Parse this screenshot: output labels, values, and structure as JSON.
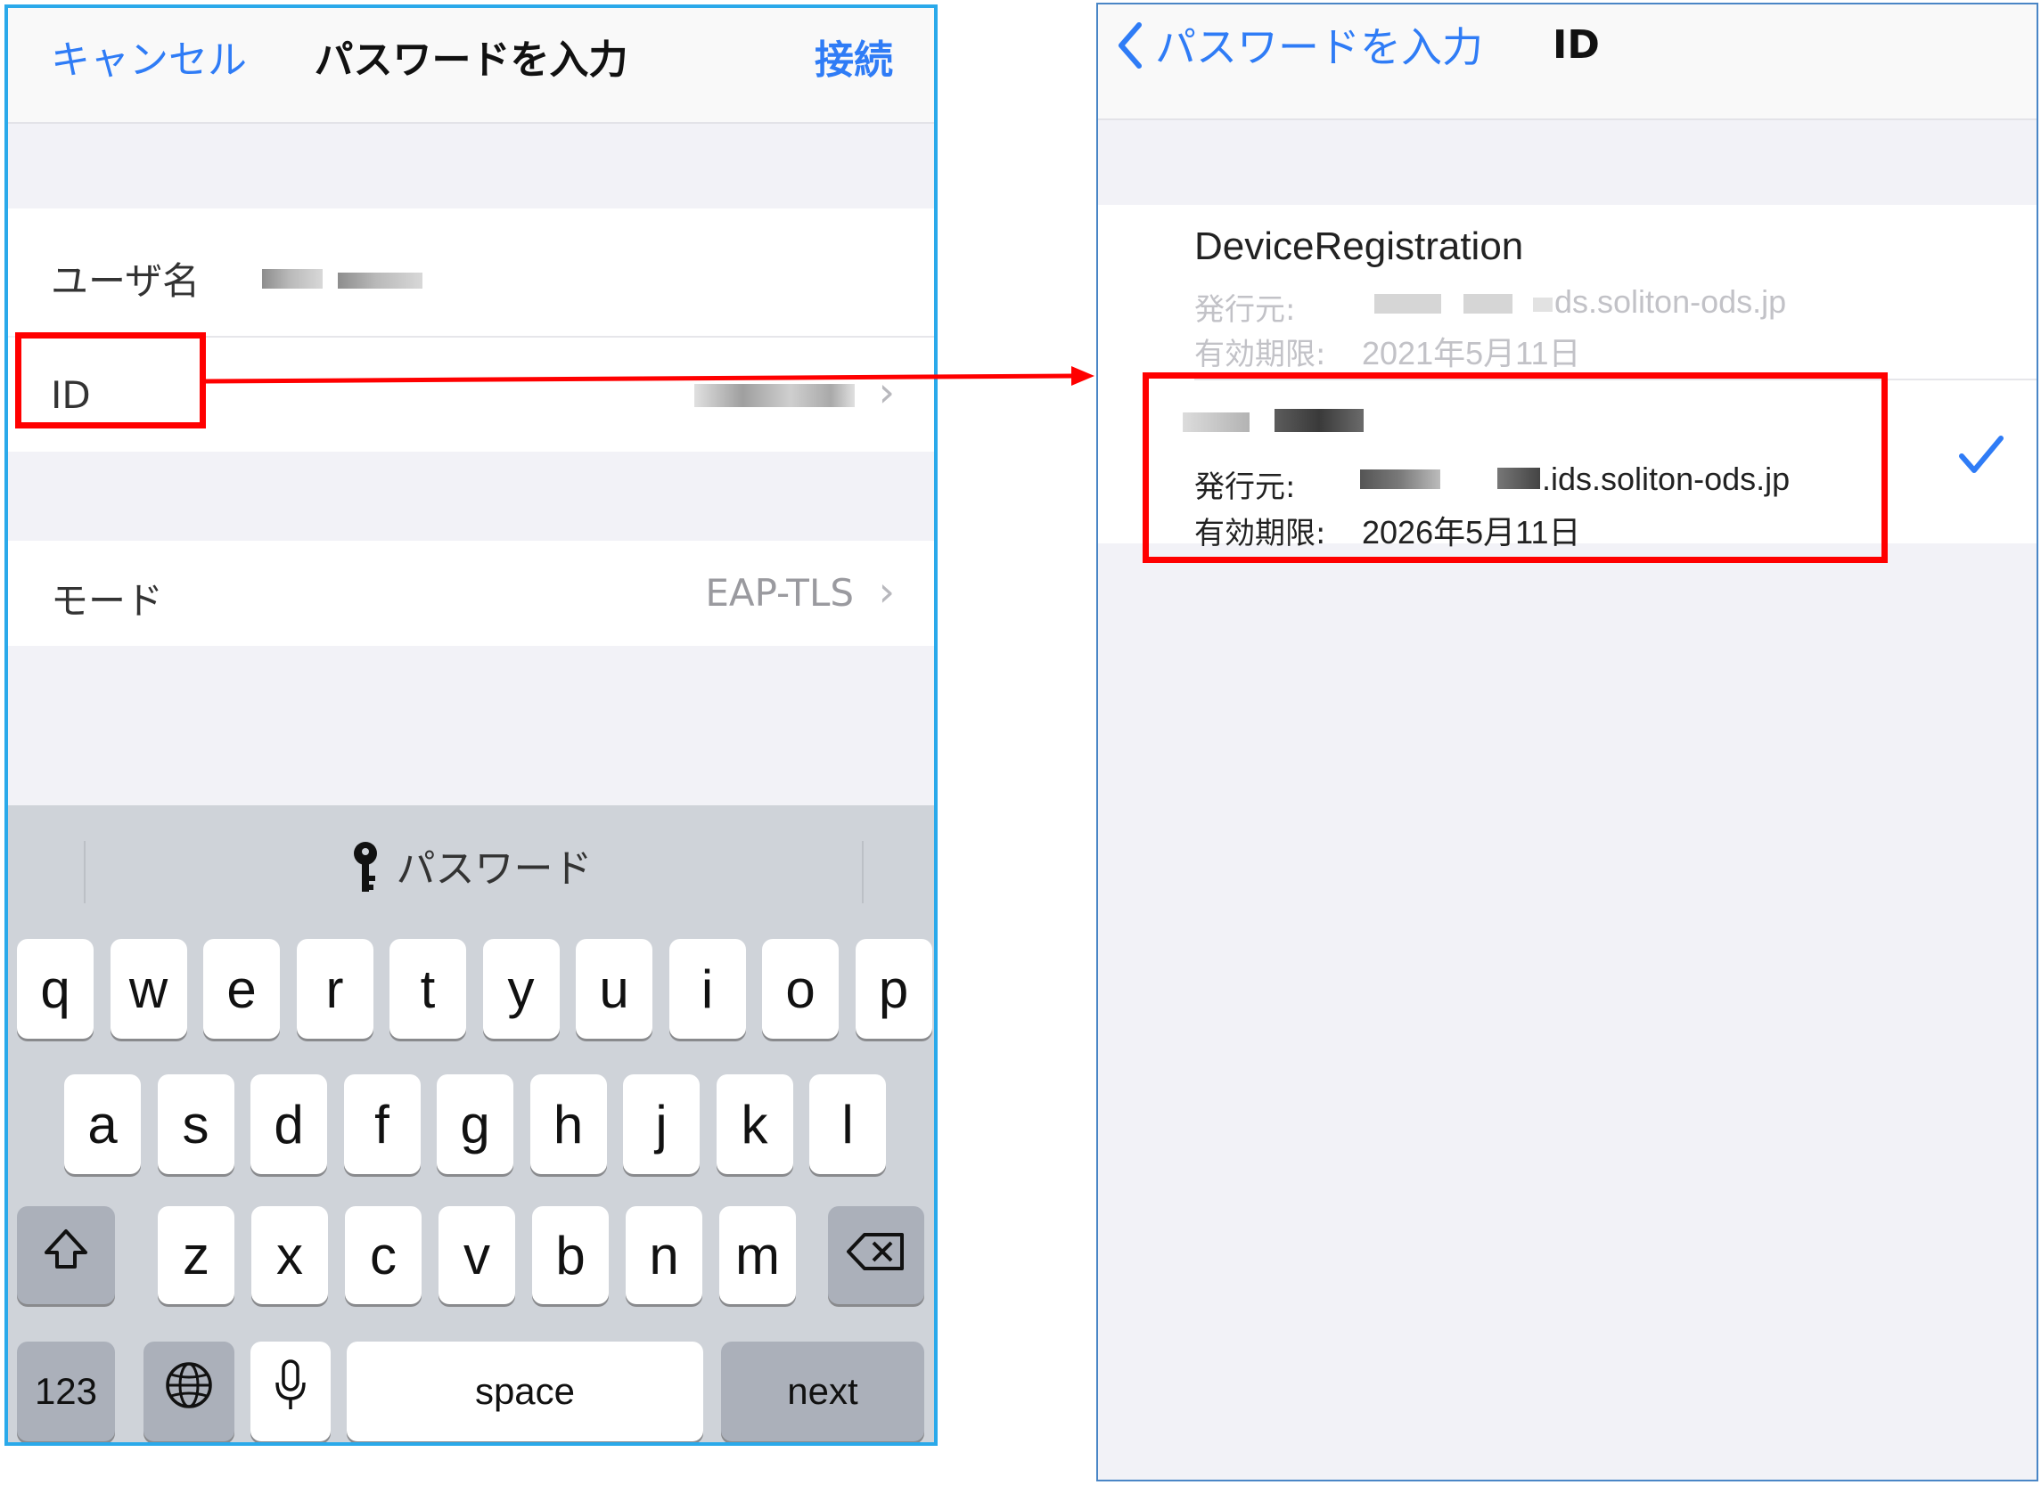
{
  "left": {
    "nav": {
      "cancel": "キャンセル",
      "title": "パスワードを入力",
      "connect": "接続"
    },
    "rows": {
      "username_label": "ユーザ名",
      "id_label": "ID",
      "mode_label": "モード",
      "mode_value": "EAP-TLS"
    },
    "keyboard": {
      "suggestion": "パスワード",
      "row1": [
        "q",
        "w",
        "e",
        "r",
        "t",
        "y",
        "u",
        "i",
        "o",
        "p"
      ],
      "row2": [
        "a",
        "s",
        "d",
        "f",
        "g",
        "h",
        "j",
        "k",
        "l"
      ],
      "row3": [
        "z",
        "x",
        "c",
        "v",
        "b",
        "n",
        "m"
      ],
      "num_key": "123",
      "space_key": "space",
      "next_key": "next",
      "icons": {
        "shift": "shift-icon",
        "delete": "delete-icon",
        "globe": "globe-icon",
        "mic": "microphone-icon",
        "key": "key-icon"
      }
    }
  },
  "right": {
    "nav": {
      "back_label": "パスワードを入力",
      "title": "ID"
    },
    "certificates": [
      {
        "name": "DeviceRegistration",
        "issuer_label": "発行元:",
        "issuer_value": "ds.soliton-ods.jp",
        "expiry_label": "有効期限:",
        "expiry_value": "2021年5月11日",
        "selected": false
      },
      {
        "name": "",
        "issuer_label": "発行元:",
        "issuer_value": ".ids.soliton-ods.jp",
        "expiry_label": "有効期限:",
        "expiry_value": "2026年5月11日",
        "selected": true
      }
    ]
  },
  "colors": {
    "accent": "#2f7cf6",
    "highlight": "#ff0000",
    "left_frame": "#2aa9ea",
    "right_frame": "#4a86c6"
  }
}
